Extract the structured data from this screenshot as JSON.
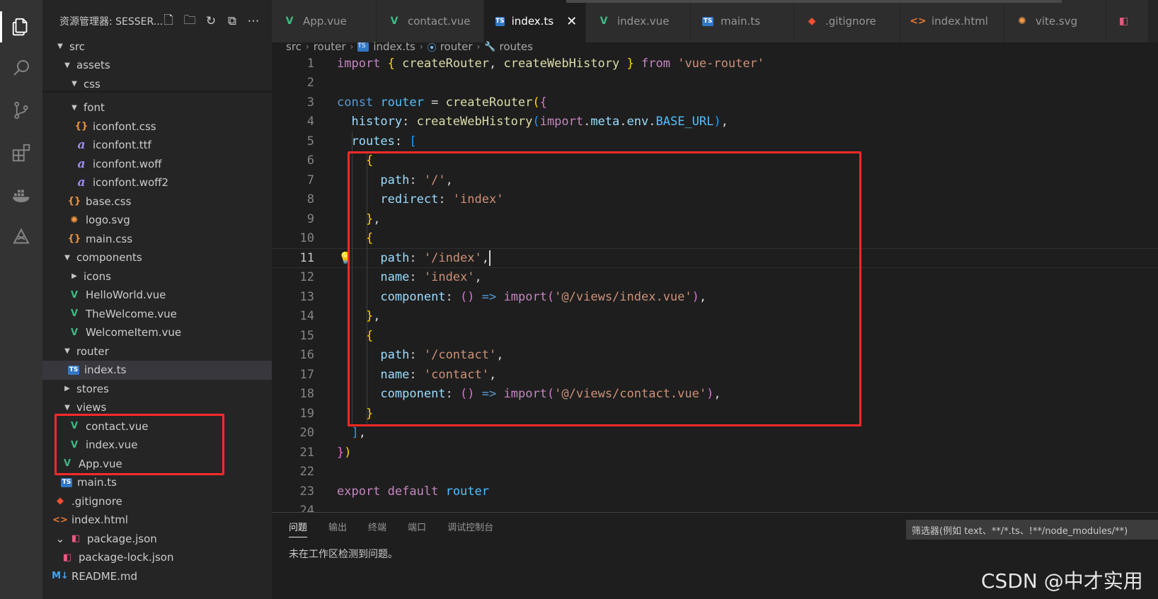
{
  "activity_bar": {
    "items": [
      "explorer-icon",
      "search-icon",
      "source-control-icon",
      "extensions-icon",
      "docker-icon",
      "remote-icon"
    ]
  },
  "explorer": {
    "title": "资源管理器: SESSER...",
    "actions": [
      "new-file-icon",
      "new-folder-icon",
      "refresh-icon",
      "collapse-icon",
      "more-icon"
    ],
    "tree": [
      {
        "label": "src",
        "depth": 0,
        "type": "folder-open"
      },
      {
        "label": "assets",
        "depth": 1,
        "type": "folder-open"
      },
      {
        "label": "css",
        "depth": 2,
        "type": "folder-open"
      },
      {
        "label": "font",
        "depth": 2,
        "type": "folder-open"
      },
      {
        "label": "iconfont.css",
        "depth": 3,
        "type": "css"
      },
      {
        "label": "iconfont.ttf",
        "depth": 3,
        "type": "font"
      },
      {
        "label": "iconfont.woff",
        "depth": 3,
        "type": "font"
      },
      {
        "label": "iconfont.woff2",
        "depth": 3,
        "type": "font"
      },
      {
        "label": "base.css",
        "depth": 2,
        "type": "css"
      },
      {
        "label": "logo.svg",
        "depth": 2,
        "type": "svg"
      },
      {
        "label": "main.css",
        "depth": 2,
        "type": "css"
      },
      {
        "label": "components",
        "depth": 1,
        "type": "folder-open"
      },
      {
        "label": "icons",
        "depth": 2,
        "type": "folder-closed"
      },
      {
        "label": "HelloWorld.vue",
        "depth": 2,
        "type": "vue"
      },
      {
        "label": "TheWelcome.vue",
        "depth": 2,
        "type": "vue"
      },
      {
        "label": "WelcomeItem.vue",
        "depth": 2,
        "type": "vue"
      },
      {
        "label": "router",
        "depth": 1,
        "type": "folder-open"
      },
      {
        "label": "index.ts",
        "depth": 2,
        "type": "ts",
        "selected": true
      },
      {
        "label": "stores",
        "depth": 1,
        "type": "folder-closed"
      },
      {
        "label": "views",
        "depth": 1,
        "type": "folder-open"
      },
      {
        "label": "contact.vue",
        "depth": 2,
        "type": "vue"
      },
      {
        "label": "index.vue",
        "depth": 2,
        "type": "vue"
      },
      {
        "label": "App.vue",
        "depth": 1,
        "type": "vue"
      },
      {
        "label": "main.ts",
        "depth": 1,
        "type": "ts"
      },
      {
        "label": ".gitignore",
        "depth": 0,
        "type": "git"
      },
      {
        "label": "index.html",
        "depth": 0,
        "type": "html"
      },
      {
        "label": "package.json",
        "depth": 0,
        "type": "json",
        "chevron": true
      },
      {
        "label": "package-lock.json",
        "depth": 1,
        "type": "json"
      },
      {
        "label": "README.md",
        "depth": 0,
        "type": "md"
      }
    ]
  },
  "tabs": [
    {
      "label": "App.vue",
      "type": "vue"
    },
    {
      "label": "contact.vue",
      "type": "vue"
    },
    {
      "label": "index.ts",
      "type": "ts",
      "active": true
    },
    {
      "label": "index.vue",
      "type": "vue"
    },
    {
      "label": "main.ts",
      "type": "ts"
    },
    {
      "label": ".gitignore",
      "type": "git"
    },
    {
      "label": "index.html",
      "type": "html"
    },
    {
      "label": "vite.svg",
      "type": "svg"
    },
    {
      "label": "",
      "type": "json"
    }
  ],
  "breadcrumb": {
    "items": [
      "src",
      "router",
      "index.ts",
      "router",
      "routes"
    ]
  },
  "editor": {
    "current_line": 11,
    "lines": [
      {
        "n": "1",
        "tokens": [
          [
            "kw",
            "import"
          ],
          [
            "def",
            " "
          ],
          [
            "p1",
            "{"
          ],
          [
            "def",
            " "
          ],
          [
            "fn",
            "createRouter"
          ],
          [
            "def",
            ", "
          ],
          [
            "fn",
            "createWebHistory"
          ],
          [
            "def",
            " "
          ],
          [
            "p1",
            "}"
          ],
          [
            "def",
            " "
          ],
          [
            "kw",
            "from"
          ],
          [
            "def",
            " "
          ],
          [
            "str",
            "'vue-router'"
          ]
        ]
      },
      {
        "n": "2",
        "tokens": []
      },
      {
        "n": "3",
        "tokens": [
          [
            "kw2",
            "const"
          ],
          [
            "def",
            " "
          ],
          [
            "var",
            "router"
          ],
          [
            "def",
            " = "
          ],
          [
            "fn",
            "createRouter"
          ],
          [
            "p1",
            "("
          ],
          [
            "p2",
            "{"
          ]
        ]
      },
      {
        "n": "4",
        "tokens": [
          [
            "def",
            "  "
          ],
          [
            "prop",
            "history"
          ],
          [
            "def",
            ": "
          ],
          [
            "fn",
            "createWebHistory"
          ],
          [
            "p3",
            "("
          ],
          [
            "kw",
            "import"
          ],
          [
            "def",
            "."
          ],
          [
            "prop",
            "meta"
          ],
          [
            "def",
            "."
          ],
          [
            "prop",
            "env"
          ],
          [
            "def",
            "."
          ],
          [
            "const",
            "BASE_URL"
          ],
          [
            "p3",
            ")"
          ],
          [
            "def",
            ","
          ]
        ]
      },
      {
        "n": "5",
        "tokens": [
          [
            "def",
            "  "
          ],
          [
            "prop",
            "routes"
          ],
          [
            "def",
            ": "
          ],
          [
            "p3",
            "["
          ]
        ]
      },
      {
        "n": "6",
        "tokens": [
          [
            "def",
            "    "
          ],
          [
            "p1",
            "{"
          ]
        ]
      },
      {
        "n": "7",
        "tokens": [
          [
            "def",
            "      "
          ],
          [
            "prop",
            "path"
          ],
          [
            "def",
            ": "
          ],
          [
            "str",
            "'/'"
          ],
          [
            "def",
            ","
          ]
        ]
      },
      {
        "n": "8",
        "tokens": [
          [
            "def",
            "      "
          ],
          [
            "prop",
            "redirect"
          ],
          [
            "def",
            ": "
          ],
          [
            "str",
            "'index'"
          ]
        ]
      },
      {
        "n": "9",
        "tokens": [
          [
            "def",
            "    "
          ],
          [
            "p1",
            "}"
          ],
          [
            "def",
            ","
          ]
        ]
      },
      {
        "n": "10",
        "tokens": [
          [
            "def",
            "    "
          ],
          [
            "p1",
            "{"
          ]
        ]
      },
      {
        "n": "11",
        "tokens": [
          [
            "def",
            "      "
          ],
          [
            "prop",
            "path"
          ],
          [
            "def",
            ": "
          ],
          [
            "str",
            "'/index'"
          ],
          [
            "def",
            ","
          ]
        ]
      },
      {
        "n": "12",
        "tokens": [
          [
            "def",
            "      "
          ],
          [
            "prop",
            "name"
          ],
          [
            "def",
            ": "
          ],
          [
            "str",
            "'index'"
          ],
          [
            "def",
            ","
          ]
        ]
      },
      {
        "n": "13",
        "tokens": [
          [
            "def",
            "      "
          ],
          [
            "prop",
            "component"
          ],
          [
            "def",
            ": "
          ],
          [
            "p2",
            "()"
          ],
          [
            "def",
            " "
          ],
          [
            "kw2",
            "=>"
          ],
          [
            "def",
            " "
          ],
          [
            "kw",
            "import"
          ],
          [
            "p2",
            "("
          ],
          [
            "str",
            "'@/views/index.vue'"
          ],
          [
            "p2",
            ")"
          ],
          [
            "def",
            ","
          ]
        ]
      },
      {
        "n": "14",
        "tokens": [
          [
            "def",
            "    "
          ],
          [
            "p1",
            "}"
          ],
          [
            "def",
            ","
          ]
        ]
      },
      {
        "n": "15",
        "tokens": [
          [
            "def",
            "    "
          ],
          [
            "p1",
            "{"
          ]
        ]
      },
      {
        "n": "16",
        "tokens": [
          [
            "def",
            "      "
          ],
          [
            "prop",
            "path"
          ],
          [
            "def",
            ": "
          ],
          [
            "str",
            "'/contact'"
          ],
          [
            "def",
            ","
          ]
        ]
      },
      {
        "n": "17",
        "tokens": [
          [
            "def",
            "      "
          ],
          [
            "prop",
            "name"
          ],
          [
            "def",
            ": "
          ],
          [
            "str",
            "'contact'"
          ],
          [
            "def",
            ","
          ]
        ]
      },
      {
        "n": "18",
        "tokens": [
          [
            "def",
            "      "
          ],
          [
            "prop",
            "component"
          ],
          [
            "def",
            ": "
          ],
          [
            "p2",
            "()"
          ],
          [
            "def",
            " "
          ],
          [
            "kw2",
            "=>"
          ],
          [
            "def",
            " "
          ],
          [
            "kw",
            "import"
          ],
          [
            "p2",
            "("
          ],
          [
            "str",
            "'@/views/contact.vue'"
          ],
          [
            "p2",
            ")"
          ],
          [
            "def",
            ","
          ]
        ]
      },
      {
        "n": "19",
        "tokens": [
          [
            "def",
            "    "
          ],
          [
            "p1",
            "}"
          ]
        ]
      },
      {
        "n": "20",
        "tokens": [
          [
            "def",
            "  "
          ],
          [
            "p3",
            "]"
          ],
          [
            "def",
            ","
          ]
        ]
      },
      {
        "n": "21",
        "tokens": [
          [
            "p2",
            "}"
          ],
          [
            "p1",
            ")"
          ]
        ]
      },
      {
        "n": "22",
        "tokens": []
      },
      {
        "n": "23",
        "tokens": [
          [
            "kw",
            "export"
          ],
          [
            "def",
            " "
          ],
          [
            "kw",
            "default"
          ],
          [
            "def",
            " "
          ],
          [
            "var",
            "router"
          ]
        ]
      },
      {
        "n": "24",
        "tokens": []
      }
    ]
  },
  "panel": {
    "tabs": [
      "问题",
      "输出",
      "终端",
      "端口",
      "调试控制台"
    ],
    "active_tab": "问题",
    "filter_placeholder": "筛选器(例如 text、**/*.ts、!**/node_modules/**)",
    "message": "未在工作区检测到问题。"
  },
  "watermark": "CSDN @中才实用",
  "colors": {
    "annotation": "#ff2a2a",
    "vue": "#41b883",
    "ts": "#3178c6"
  }
}
